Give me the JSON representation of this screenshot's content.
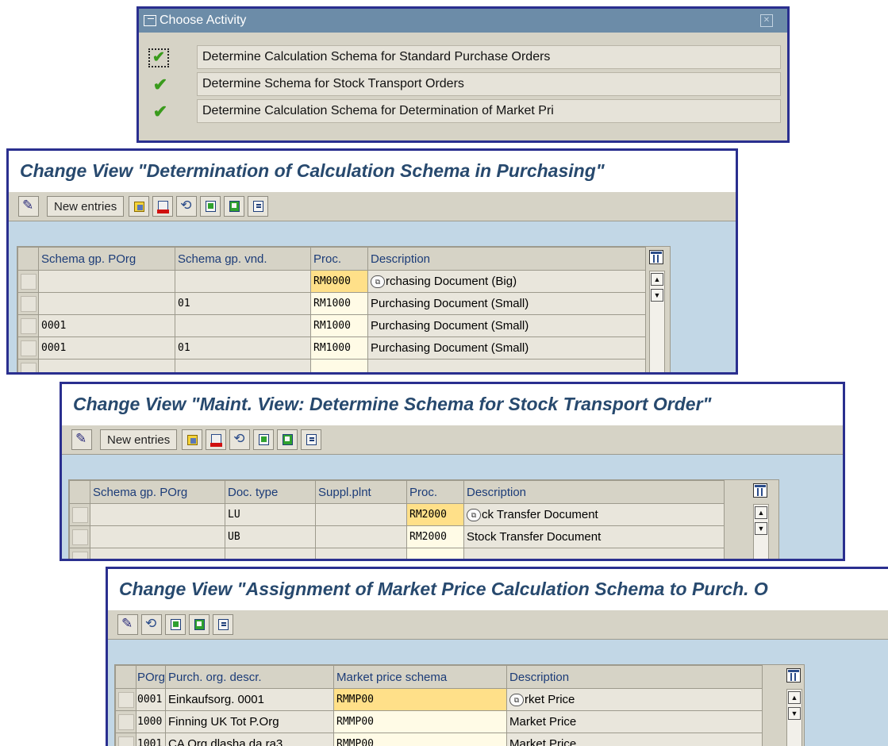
{
  "dialog": {
    "title": "Choose Activity",
    "activities": [
      {
        "label": "Determine Calculation Schema for Standard Purchase Orders",
        "selected": true
      },
      {
        "label": "Determine Schema for Stock Transport Orders",
        "selected": false
      },
      {
        "label": "Determine Calculation Schema for Determination of Market Pri",
        "selected": false
      }
    ]
  },
  "win1": {
    "title": "Change View \"Determination of Calculation Schema in Purchasing\"",
    "new_entries": "New entries",
    "columns": [
      "Schema gp. POrg",
      "Schema gp. vnd.",
      "Proc.",
      "Description"
    ],
    "rows": [
      {
        "porg": "",
        "vnd": "",
        "proc": "RM0000",
        "desc": "rchasing Document (Big)"
      },
      {
        "porg": "",
        "vnd": "01",
        "proc": "RM1000",
        "desc": "Purchasing Document (Small)"
      },
      {
        "porg": "0001",
        "vnd": "",
        "proc": "RM1000",
        "desc": "Purchasing Document (Small)"
      },
      {
        "porg": "0001",
        "vnd": "01",
        "proc": "RM1000",
        "desc": "Purchasing Document (Small)"
      }
    ]
  },
  "win2": {
    "title": "Change View \"Maint. View: Determine Schema for Stock Transport Order\"",
    "new_entries": "New entries",
    "columns": [
      "Schema gp. POrg",
      "Doc. type",
      "Suppl.plnt",
      "Proc.",
      "Description"
    ],
    "rows": [
      {
        "porg": "",
        "doctype": "LU",
        "plnt": "",
        "proc": "RM2000",
        "desc": "ck Transfer Document"
      },
      {
        "porg": "",
        "doctype": "UB",
        "plnt": "",
        "proc": "RM2000",
        "desc": "Stock Transfer Document"
      }
    ]
  },
  "win3": {
    "title": "Change View \"Assignment of Market Price Calculation Schema to Purch. O",
    "columns": [
      "POrg",
      "Purch. org. descr.",
      "Market price schema",
      "Description"
    ],
    "rows": [
      {
        "porg": "0001",
        "descr": "Einkaufsorg. 0001",
        "schema": "RMMP00",
        "desc": "rket Price"
      },
      {
        "porg": "1000",
        "descr": "Finning UK Tot P.Org",
        "schema": "RMMP00",
        "desc": "Market Price"
      },
      {
        "porg": "1001",
        "descr": "CA Org dlasha da ra3",
        "schema": "RMMP00",
        "desc": "Market Price"
      }
    ]
  }
}
